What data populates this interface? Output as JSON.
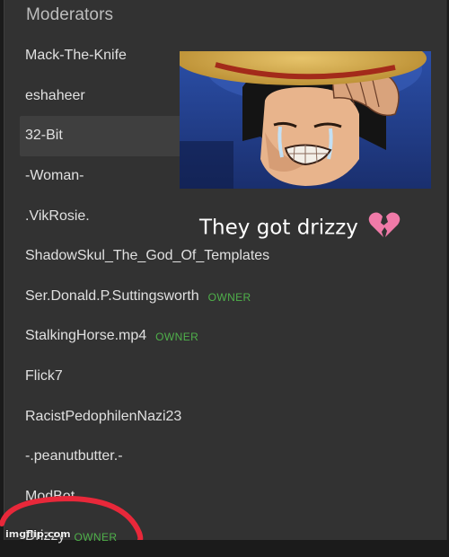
{
  "moderators": {
    "title": "Moderators",
    "items": [
      {
        "name": "Mack-The-Knife",
        "badge": ""
      },
      {
        "name": "eshaheer",
        "badge": ""
      },
      {
        "name": "32-Bit",
        "badge": "",
        "selected": true
      },
      {
        "name": "-Woman-",
        "badge": ""
      },
      {
        "name": ".VikRosie.",
        "badge": ""
      },
      {
        "name": "ShadowSkul_The_God_Of_Templates",
        "badge": ""
      },
      {
        "name": "Ser.Donald.P.Suttingsworth",
        "badge": "OWNER"
      },
      {
        "name": "StalkingHorse.mp4",
        "badge": "OWNER"
      },
      {
        "name": "Flick7",
        "badge": ""
      },
      {
        "name": "RacistPedophilenNazi23",
        "badge": ""
      },
      {
        "name": "-.peanutbutter.-",
        "badge": ""
      },
      {
        "name": "ModBot",
        "badge": ""
      },
      {
        "name": "Drizzy",
        "badge": "OWNER"
      }
    ]
  },
  "meme": {
    "caption": "They got drizzy",
    "heart_icon": "broken-heart-icon",
    "image_icon": "crying-anime-character-image",
    "watermark": "imgflip.com"
  },
  "colors": {
    "panel_bg": "#323232",
    "text": "#e0e0e0",
    "owner_badge": "#4fb04a",
    "annotation_circle": "#e8283a"
  }
}
